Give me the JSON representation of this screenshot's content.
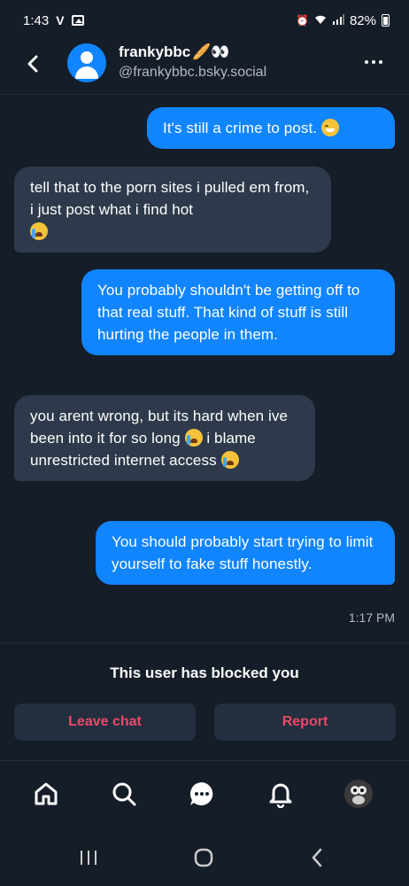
{
  "status_bar": {
    "time": "1:43",
    "carrier_badge": "V",
    "battery": "82%"
  },
  "header": {
    "display_name": "frankybbc",
    "name_emoji": "🥖👀",
    "handle": "@frankybbc.bsky.social"
  },
  "messages": [
    {
      "sender": "me",
      "text": "It's still a crime to post.",
      "emoji": "sweat-smile"
    },
    {
      "sender": "them",
      "text": "tell that to the porn sites i pulled em from, i just post what i find hot",
      "emoji": "crying"
    },
    {
      "sender": "me",
      "text": "You probably shouldn't be getting off to that real stuff. That kind of stuff is still hurting the people in them."
    },
    {
      "sender": "them",
      "text_1": "you arent wrong, but its hard when ive been into it for so long",
      "text_2": "i blame unrestricted internet access",
      "emoji": "crying"
    },
    {
      "sender": "me",
      "text": "You should probably start trying to limit yourself to fake stuff honestly."
    }
  ],
  "timestamp": "1:17 PM",
  "blocked_notice": "This user has blocked you",
  "actions": {
    "leave": "Leave chat",
    "report": "Report"
  },
  "colors": {
    "background": "#151d28",
    "my_bubble": "#1185fe",
    "their_bubble": "#2e3a4b",
    "danger": "#ec4868"
  }
}
